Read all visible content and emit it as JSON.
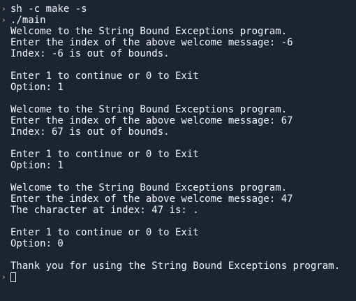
{
  "terminal": {
    "prompt_symbol": "›",
    "lines": [
      "sh -c make -s",
      "./main",
      "Welcome to the String Bound Exceptions program.",
      "Enter the index of the above welcome message: -6",
      "Index: -6 is out of bounds.",
      "",
      "Enter 1 to continue or 0 to Exit",
      "Option: 1",
      "",
      "Welcome to the String Bound Exceptions program.",
      "Enter the index of the above welcome message: 67",
      "Index: 67 is out of bounds.",
      "",
      "Enter 1 to continue or 0 to Exit",
      "Option: 1",
      "",
      "Welcome to the String Bound Exceptions program.",
      "Enter the index of the above welcome message: 47",
      "The character at index: 47 is: .",
      "",
      "Enter 1 to continue or 0 to Exit",
      "Option: 0",
      "",
      "Thank you for using the String Bound Exceptions program."
    ]
  },
  "colors": {
    "background": "#1c2333",
    "text": "#f5f9fc",
    "prompt": "#e4b95e"
  }
}
